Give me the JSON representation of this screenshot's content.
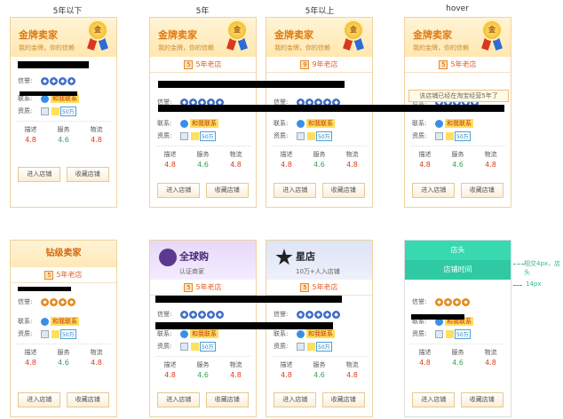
{
  "columns": [
    "5年以下",
    "5年",
    "5年以上",
    "hover"
  ],
  "gold": {
    "title": "金牌卖家",
    "subtitle": "我的金牌，你的信赖",
    "medal": "金"
  },
  "years": {
    "y5": "5年老店",
    "y9": "9年老店"
  },
  "hover_tip": "该店铺已经在淘宝经营5年了",
  "labels": {
    "reputation": "信誉:",
    "contact": "联系:",
    "credential": "资质:",
    "ww": "和我联系",
    "bao": "50万",
    "desc": "描述",
    "service": "服务",
    "logistics": "物流",
    "enter": "进入店铺",
    "fav": "收藏店铺"
  },
  "scores": {
    "desc": "4.8",
    "service": "4.6",
    "logistics": "4.8"
  },
  "diamond": {
    "title": "钻级卖家"
  },
  "global": {
    "title": "全球购",
    "subtitle": "认证商家"
  },
  "star": {
    "title": "星店",
    "subtitle": "10万+人入店铺"
  },
  "hover2": {
    "head": "店头",
    "time": "店铺时间",
    "note1": "相交4px，店头",
    "note2": "14px"
  }
}
